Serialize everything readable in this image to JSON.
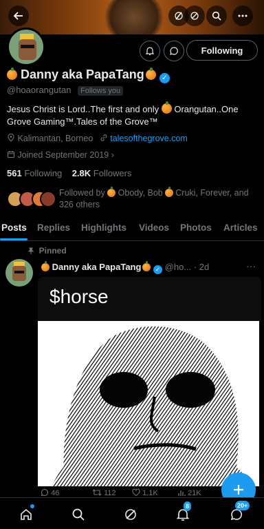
{
  "header": {
    "back_icon": "arrow-left-icon",
    "grok_icon": "slash-icon",
    "search_icon": "search-icon",
    "more_icon": "more-icon"
  },
  "profile": {
    "following_button": "Following",
    "name": "Danny aka PapaTang",
    "handle": "@hoaorangutan",
    "follows_you": "Follows you",
    "bio_part1": "Jesus Christ is Lord..The first and only",
    "bio_part2": "Orangutan..One Grove Gaming™.Tales of the Grove™",
    "location": "Kalimantan, Borneo",
    "website": "talesofthegrove.com",
    "joined": "Joined September 2019",
    "following_count": "561",
    "following_label": "Following",
    "followers_count": "2.8K",
    "followers_label": "Followers",
    "followed_by_prefix": "Followed by",
    "followed_by_1": "Obody, Bob",
    "followed_by_2": "Cruki, Forever, and",
    "followed_by_others": "326 others"
  },
  "tabs": [
    {
      "label": "Posts"
    },
    {
      "label": "Replies"
    },
    {
      "label": "Highlights"
    },
    {
      "label": "Videos"
    },
    {
      "label": "Photos"
    },
    {
      "label": "Articles"
    }
  ],
  "post": {
    "pinned_label": "Pinned",
    "author_name": "Danny aka PapaTang",
    "author_handle": "@ho...",
    "time": "· 2d",
    "caption": "$horse",
    "replies": "46",
    "reposts": "112",
    "likes": "1.1K",
    "views": "21K"
  },
  "bottom_nav": {
    "notifications_badge": "8",
    "messages_badge": "20+"
  },
  "colors": {
    "accent": "#1d9bf0",
    "background": "#000000",
    "muted_text": "#71767b"
  }
}
